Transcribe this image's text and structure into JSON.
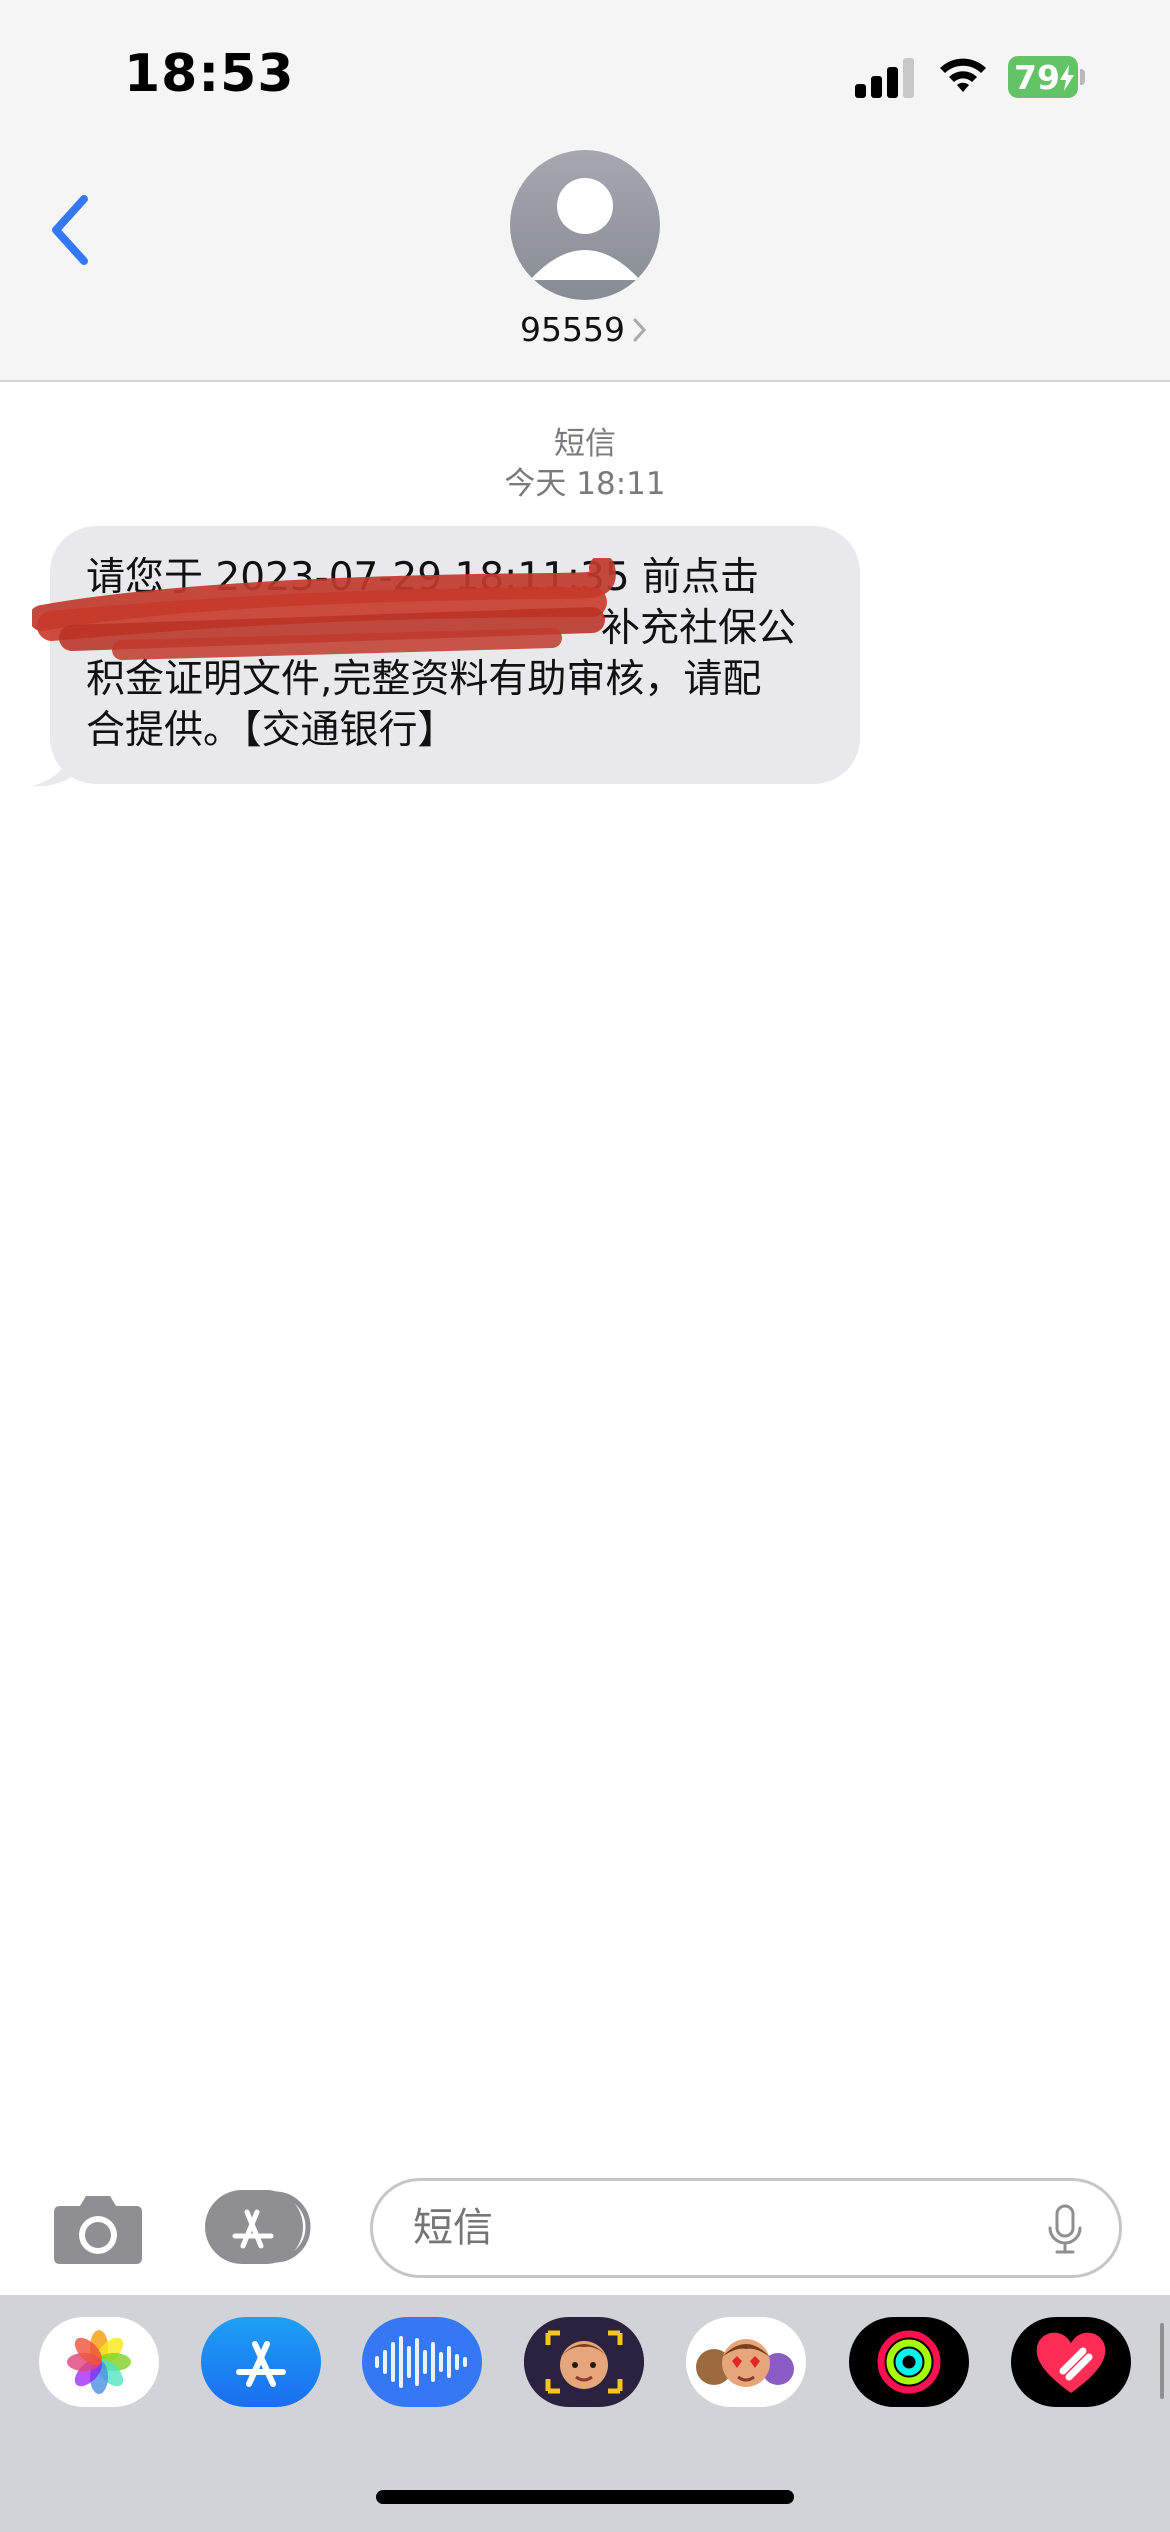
{
  "status_bar": {
    "time": "18:53",
    "battery_percent": "79",
    "signal_icon": "cellular-signal-icon",
    "wifi_icon": "wifi-icon",
    "battery_color": "#63c467"
  },
  "header": {
    "contact_name": "95559",
    "back_icon": "chevron-left-icon",
    "accent_color": "#3478f6"
  },
  "conversation": {
    "service_label": "短信",
    "timestamp": "今天 18:11",
    "messages": [
      {
        "direction": "incoming",
        "line1": "请您于 2023-07-29 18:11:35 前点击",
        "line2_visible": "补充社保公",
        "line3": "积金证明文件,完整资料有助审核，请配",
        "line4": "合提供。【交通银行】",
        "redacted_region": "link text scribbled out in red"
      }
    ]
  },
  "composer": {
    "placeholder": "短信",
    "camera_icon": "camera-icon",
    "apps_icon": "app-store-icon",
    "mic_icon": "microphone-icon"
  },
  "app_drawer": {
    "apps": [
      {
        "name": "photos-app-icon"
      },
      {
        "name": "app-store-app-icon"
      },
      {
        "name": "audio-message-app-icon"
      },
      {
        "name": "memoji-app-icon"
      },
      {
        "name": "memoji-stickers-app-icon"
      },
      {
        "name": "activity-app-icon"
      },
      {
        "name": "digital-touch-app-icon"
      }
    ]
  }
}
